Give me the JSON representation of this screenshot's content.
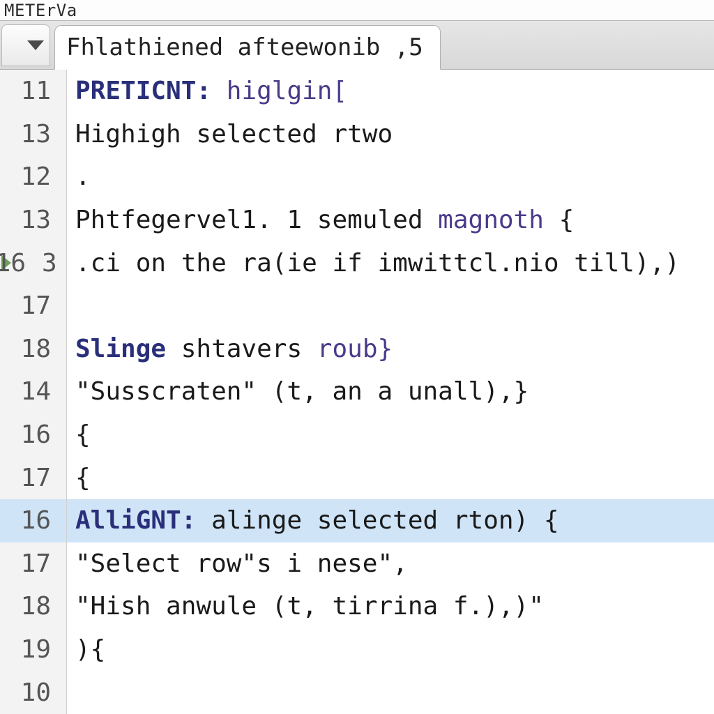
{
  "title": "METErVa",
  "tab": {
    "label": "Fhlathiened afteewonib ,5"
  },
  "lines": [
    {
      "num": "11",
      "segments": [
        {
          "t": "PRETICNT:",
          "cls": "kw"
        },
        {
          "t": " ",
          "cls": "plain"
        },
        {
          "t": "higlgin[",
          "cls": "id"
        }
      ]
    },
    {
      "num": "13",
      "segments": [
        {
          "t": "Highigh selected rtwo",
          "cls": "plain"
        }
      ]
    },
    {
      "num": "12",
      "segments": [
        {
          "t": ".",
          "cls": "plain"
        }
      ]
    },
    {
      "num": "13",
      "segments": [
        {
          "t": "Phtfegervel1. 1 semuled ",
          "cls": "plain"
        },
        {
          "t": "magnoth",
          "cls": "id"
        },
        {
          "t": " {",
          "cls": "plain"
        }
      ]
    },
    {
      "num": "16",
      "bp": "3",
      "segments": [
        {
          "t": ".ci on the ra(ie if imwittcl.nio till),)",
          "cls": "plain"
        }
      ]
    },
    {
      "num": "17",
      "segments": []
    },
    {
      "num": "18",
      "segments": [
        {
          "t": "Slinge",
          "cls": "kw"
        },
        {
          "t": " shtavers ",
          "cls": "plain"
        },
        {
          "t": "roub}",
          "cls": "id"
        }
      ]
    },
    {
      "num": "14",
      "segments": [
        {
          "t": "\"Susscraten\" (t, an a unall),}",
          "cls": "plain"
        }
      ]
    },
    {
      "num": "16",
      "segments": [
        {
          "t": "{",
          "cls": "plain"
        }
      ]
    },
    {
      "num": "17",
      "segments": [
        {
          "t": "{",
          "cls": "plain"
        }
      ]
    },
    {
      "num": "16",
      "hl": true,
      "segments": [
        {
          "t": "AlliGNT:",
          "cls": "kw"
        },
        {
          "t": " alinge selected rton) {",
          "cls": "plain"
        }
      ]
    },
    {
      "num": "17",
      "segments": [
        {
          "t": "\"Select row\"s i nese\",",
          "cls": "plain"
        }
      ]
    },
    {
      "num": "18",
      "segments": [
        {
          "t": "\"Hish anwule (t, tirrina f.),)\"",
          "cls": "plain"
        }
      ]
    },
    {
      "num": "19",
      "segments": [
        {
          "t": "){",
          "cls": "plain"
        }
      ]
    },
    {
      "num": "10",
      "segments": []
    }
  ]
}
